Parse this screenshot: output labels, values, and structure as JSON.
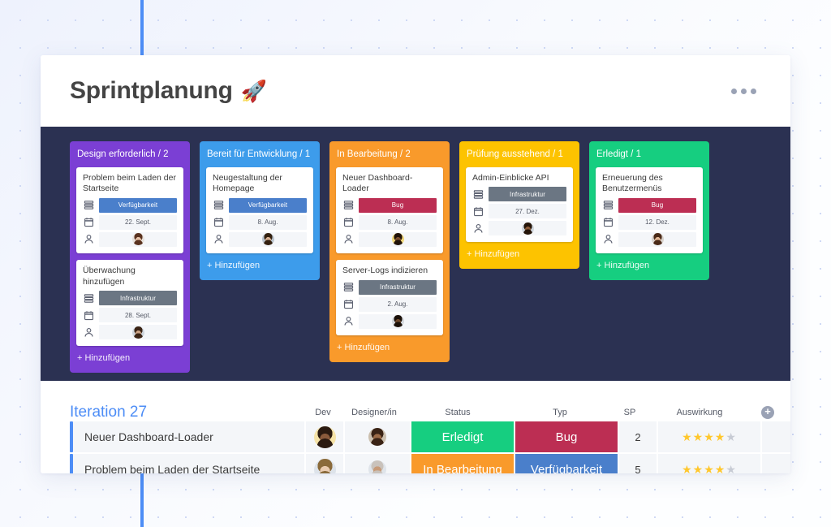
{
  "header": {
    "title": "Sprintplanung",
    "emoji": "🚀",
    "more_label": "···"
  },
  "board": {
    "background_color": "#2b3152",
    "add_label": "+ Hinzufügen",
    "columns": [
      {
        "title": "Design erforderlich / 2",
        "color": "#7b3fd4",
        "cards": [
          {
            "title": "Problem beim Laden der Startseite",
            "tag": "Verfügbarkeit",
            "tag_color": "#4a7fcb",
            "date": "22. Sept.",
            "avatar": "woman-1"
          },
          {
            "title": "Überwachung hinzufügen",
            "tag": "Infrastruktur",
            "tag_color": "#6b7683",
            "date": "28. Sept.",
            "avatar": "man-1"
          }
        ]
      },
      {
        "title": "Bereit für Entwicklung / 1",
        "color": "#3d9ceb",
        "cards": [
          {
            "title": "Neugestaltung der Homepage",
            "tag": "Verfügbarkeit",
            "tag_color": "#4a7fcb",
            "date": "8. Aug.",
            "avatar": "man-2"
          }
        ]
      },
      {
        "title": "In Bearbeitung / 2",
        "color": "#f99a2b",
        "cards": [
          {
            "title": "Neuer Dashboard-Loader",
            "tag": "Bug",
            "tag_color": "#bc2e53",
            "date": "8. Aug.",
            "avatar": "man-3"
          },
          {
            "title": "Server-Logs indizieren",
            "tag": "Infrastruktur",
            "tag_color": "#6b7683",
            "date": "2. Aug.",
            "avatar": "man-4"
          }
        ]
      },
      {
        "title": "Prüfung ausstehend / 1",
        "color": "#fdc300",
        "cards": [
          {
            "title": "Admin-Einblicke API",
            "tag": "Infrastruktur",
            "tag_color": "#6b7683",
            "date": "27. Dez.",
            "avatar": "man-5"
          }
        ]
      },
      {
        "title": "Erledigt / 1",
        "color": "#16ce80",
        "cards": [
          {
            "title": "Erneuerung des Benutzermenüs",
            "tag": "Bug",
            "tag_color": "#bc2e53",
            "date": "12. Dez.",
            "avatar": "woman-2"
          }
        ]
      }
    ]
  },
  "table": {
    "title": "Iteration 27",
    "add_button": "+",
    "columns": [
      "Dev",
      "Designer/in",
      "Status",
      "Typ",
      "SP",
      "Auswirkung"
    ],
    "rows": [
      {
        "name": "Neuer Dashboard-Loader",
        "dev_avatar": "woman-3",
        "designer_avatar": "woman-4",
        "status": "Erledigt",
        "status_color": "#16ce80",
        "typ": "Bug",
        "typ_color": "#bc2e53",
        "sp": "2",
        "impact_filled": 4,
        "impact_total": 5
      },
      {
        "name": "Problem beim Laden der Startseite",
        "dev_avatar": "woman-5",
        "designer_avatar": "man-6",
        "status": "In Bearbeitung",
        "status_color": "#f99a2b",
        "typ": "Verfügbarkeit",
        "typ_color": "#4a7fcb",
        "sp": "5",
        "impact_filled": 4,
        "impact_total": 5
      }
    ]
  }
}
